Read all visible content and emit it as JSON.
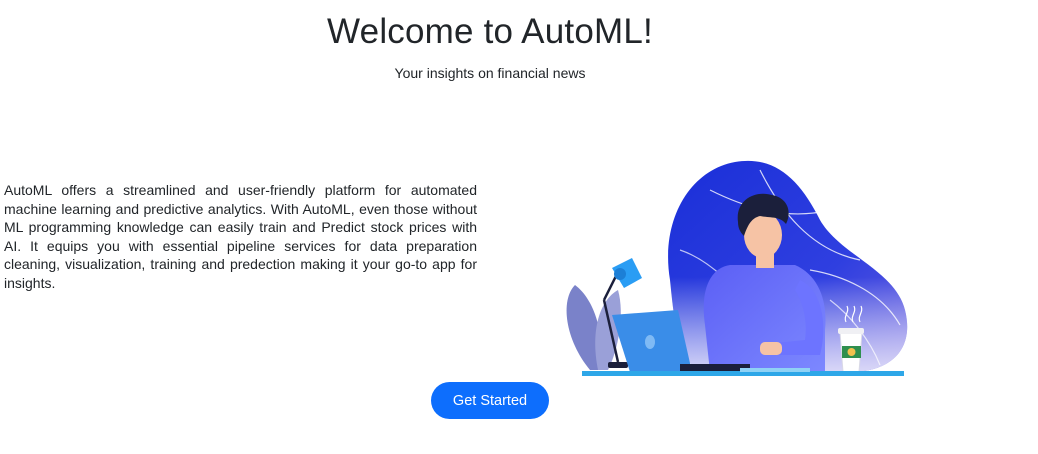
{
  "header": {
    "title": "Welcome to AutoML!",
    "subtitle": "Your insights on financial news"
  },
  "main": {
    "description": "AutoML offers a streamlined and user-friendly platform for automated machine learning and predictive analytics. With AutoML, even those without ML programming knowledge can easily train and Predict stock prices with AI. It equips you with essential pipeline services for data preparation cleaning, visualization, training and predection making it your go-to app for insights.",
    "cta_label": "Get Started"
  },
  "colors": {
    "accent": "#0d6efd",
    "blob": "#2b3bd9",
    "shirt": "#5a6cf7",
    "desk": "#2ea7e8"
  }
}
